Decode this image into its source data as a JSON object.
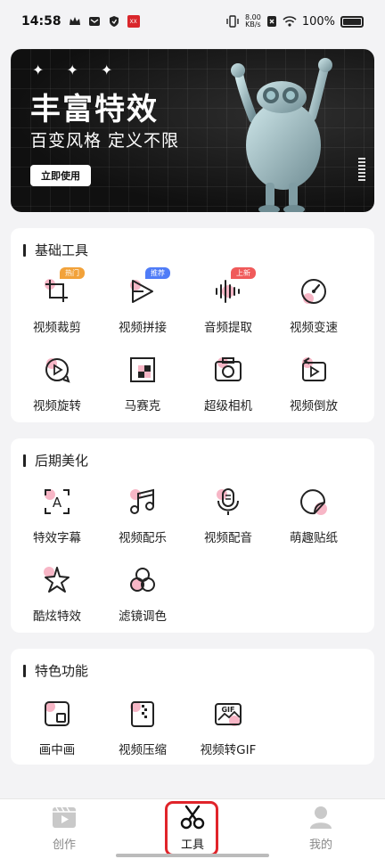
{
  "status_bar": {
    "time": "14:58",
    "netspeed_value": "8.00",
    "netspeed_unit": "KB/s",
    "battery_text": "100%",
    "mini_tag": "XX"
  },
  "banner": {
    "stars": "✦ ✦ ✦",
    "title": "丰富特效",
    "subtitle": "百变风格 定义不限",
    "cta_label": "立即使用"
  },
  "sections": [
    {
      "title": "基础工具",
      "items": [
        {
          "label": "视频裁剪",
          "icon": "crop-icon",
          "tag": "热门",
          "tag_color": "#f2a23a"
        },
        {
          "label": "视频拼接",
          "icon": "merge-icon",
          "tag": "推荐",
          "tag_color": "#4f7cf7"
        },
        {
          "label": "音频提取",
          "icon": "audio-wave-icon",
          "tag": "上新",
          "tag_color": "#f05a5a"
        },
        {
          "label": "视频变速",
          "icon": "speedometer-icon"
        },
        {
          "label": "视频旋转",
          "icon": "rotate-icon"
        },
        {
          "label": "马赛克",
          "icon": "mosaic-icon"
        },
        {
          "label": "超级相机",
          "icon": "camera-icon"
        },
        {
          "label": "视频倒放",
          "icon": "reverse-icon"
        }
      ]
    },
    {
      "title": "后期美化",
      "items": [
        {
          "label": "特效字幕",
          "icon": "subtitle-icon"
        },
        {
          "label": "视频配乐",
          "icon": "music-note-icon"
        },
        {
          "label": "视频配音",
          "icon": "microphone-icon"
        },
        {
          "label": "萌趣贴纸",
          "icon": "sticker-icon"
        },
        {
          "label": "酷炫特效",
          "icon": "sparkle-star-icon"
        },
        {
          "label": "滤镜调色",
          "icon": "filter-circles-icon"
        }
      ]
    },
    {
      "title": "特色功能",
      "items": [
        {
          "label": "画中画",
          "icon": "picture-in-picture-icon"
        },
        {
          "label": "视频压缩",
          "icon": "compress-icon"
        },
        {
          "label": "视频转GIF",
          "icon": "gif-icon"
        }
      ]
    }
  ],
  "bottom_nav": [
    {
      "label": "创作",
      "icon": "video-clapper-icon",
      "active": false
    },
    {
      "label": "工具",
      "icon": "scissors-icon",
      "active": true
    },
    {
      "label": "我的",
      "icon": "user-icon",
      "active": false
    }
  ],
  "colors": {
    "accent_pink": "#f7b6c6",
    "highlight_red": "#e0242a",
    "background": "#f3f3f5"
  }
}
